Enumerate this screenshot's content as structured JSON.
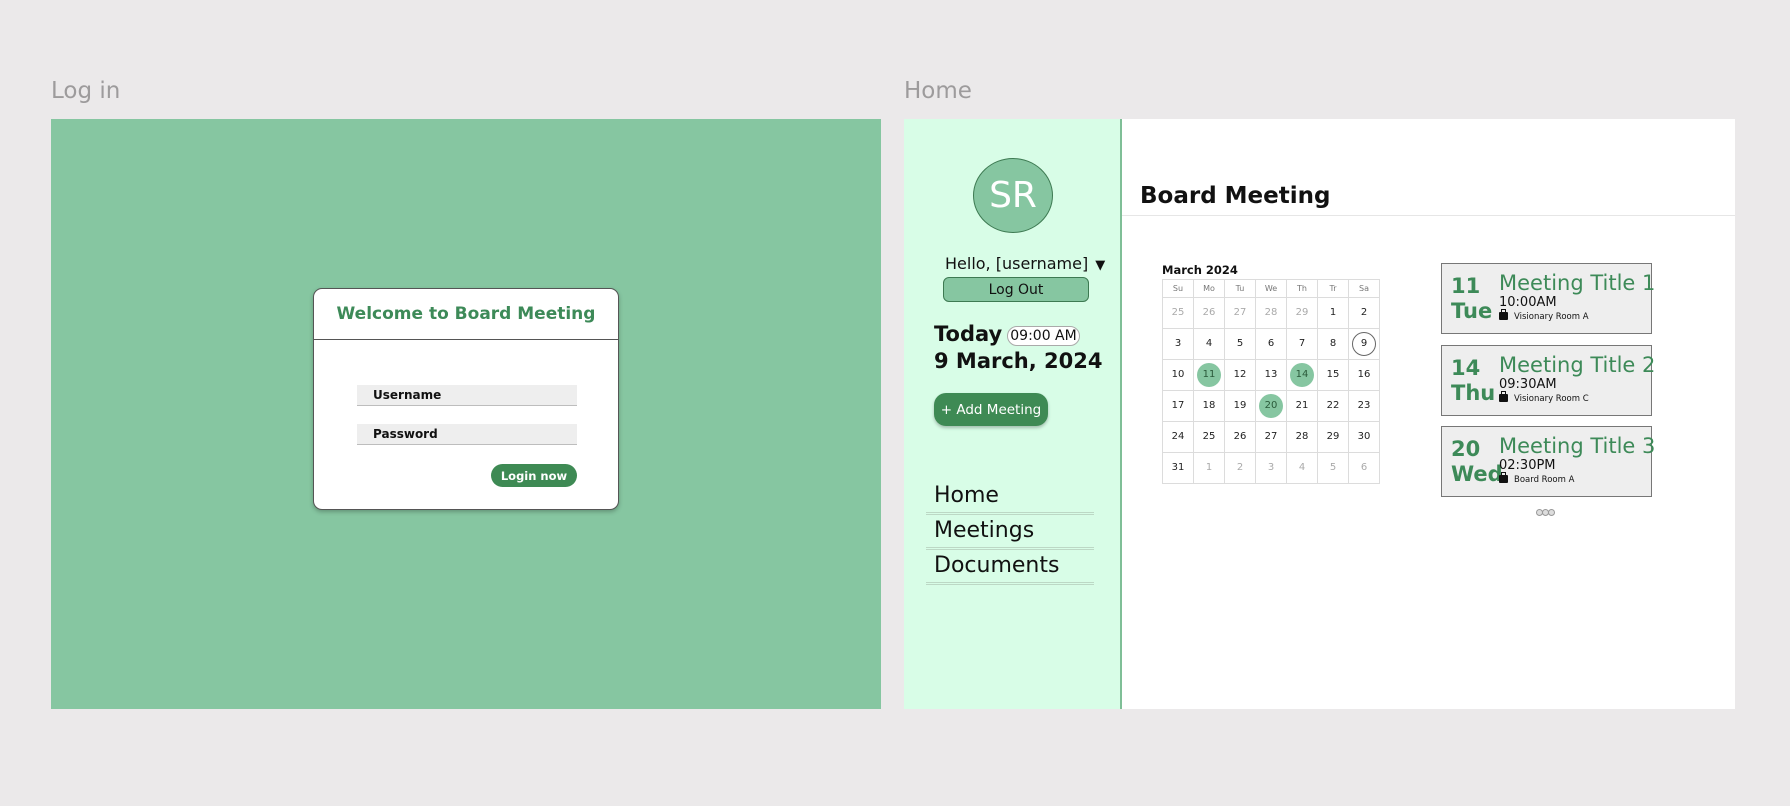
{
  "frames": {
    "login_label": "Log in",
    "home_label": "Home"
  },
  "login": {
    "title": "Welcome to Board Meeting",
    "username_label": "Username",
    "password_label": "Password",
    "submit_label": "Login now"
  },
  "sidebar": {
    "avatar_initials": "SR",
    "greeting": "Hello, [username]",
    "logout_label": "Log Out",
    "today_label": "Today",
    "today_time": "09:00 AM",
    "today_date": "9 March, 2024",
    "add_meeting_label": "+ Add Meeting",
    "nav": [
      "Home",
      "Meetings",
      "Documents"
    ]
  },
  "main": {
    "title": "Board Meeting"
  },
  "calendar": {
    "month_label": "March 2024",
    "weekdays": [
      "Su",
      "Mo",
      "Tu",
      "We",
      "Th",
      "Tr",
      "Sa"
    ],
    "weeks": [
      [
        "25",
        "26",
        "27",
        "28",
        "29",
        "1",
        "2"
      ],
      [
        "3",
        "4",
        "5",
        "6",
        "7",
        "8",
        "9"
      ],
      [
        "10",
        "11",
        "12",
        "13",
        "14",
        "15",
        "16"
      ],
      [
        "17",
        "18",
        "19",
        "20",
        "21",
        "22",
        "23"
      ],
      [
        "24",
        "25",
        "26",
        "27",
        "28",
        "29",
        "30"
      ],
      [
        "31",
        "1",
        "2",
        "3",
        "4",
        "5",
        "6"
      ]
    ],
    "highlighted_days": [
      "11",
      "14",
      "20"
    ],
    "today_day": "9"
  },
  "meetings": [
    {
      "day": "11",
      "weekday": "Tue",
      "title": "Meeting Title 1",
      "time": "10:00AM",
      "room": "Visionary Room A"
    },
    {
      "day": "14",
      "weekday": "Thu",
      "title": "Meeting Title 2",
      "time": "09:30AM",
      "room": "Visionary Room C"
    },
    {
      "day": "20",
      "weekday": "Wed",
      "title": "Meeting Title 3",
      "time": "02:30PM",
      "room": "Board Room A"
    }
  ],
  "colors": {
    "primary": "#3e8a54",
    "accent": "#86c6a1",
    "sidebar_bg": "#d8fde7"
  },
  "icons": {
    "greeting_caret": "caret-down-icon",
    "room": "briefcase-icon"
  }
}
